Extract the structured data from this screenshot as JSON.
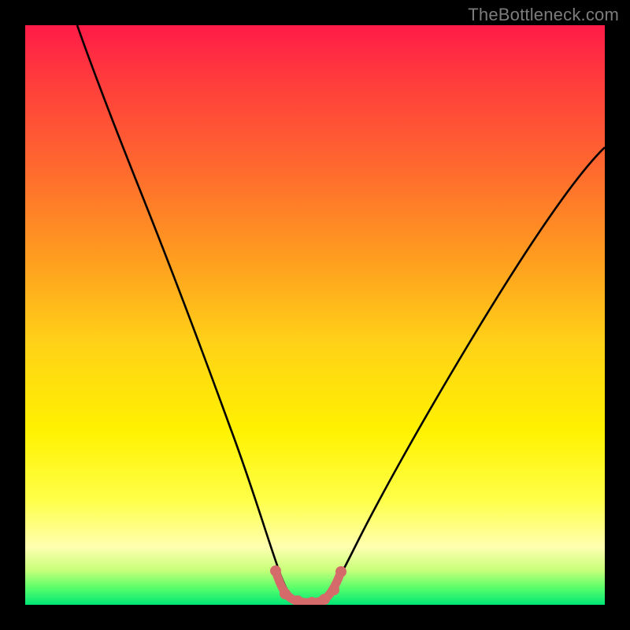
{
  "watermark": "TheBottleneck.com",
  "colors": {
    "frame": "#000000",
    "gradient_top": "#ff1b48",
    "gradient_mid": "#fff200",
    "gradient_bottom": "#00e676",
    "curve": "#000000",
    "marker": "#d46a6a"
  },
  "chart_data": {
    "type": "line",
    "title": "",
    "xlabel": "",
    "ylabel": "",
    "xlim": [
      0,
      100
    ],
    "ylim": [
      0,
      100
    ],
    "grid": false,
    "legend": false,
    "annotations": [],
    "series": [
      {
        "name": "bottleneck-curve",
        "x": [
          9,
          12,
          18,
          24,
          30,
          34,
          38,
          41,
          43.5,
          45,
          47,
          49.5,
          51,
          55,
          62,
          72,
          84,
          96,
          100
        ],
        "y": [
          100,
          92,
          78,
          64,
          48,
          36,
          24,
          13,
          5,
          1,
          0.3,
          0.3,
          1,
          5,
          16,
          34,
          54,
          73,
          79
        ]
      },
      {
        "name": "optimal-markers",
        "x": [
          43.5,
          45,
          47,
          49.5,
          51
        ],
        "y": [
          5,
          1,
          0.3,
          0.3,
          1
        ]
      }
    ]
  }
}
